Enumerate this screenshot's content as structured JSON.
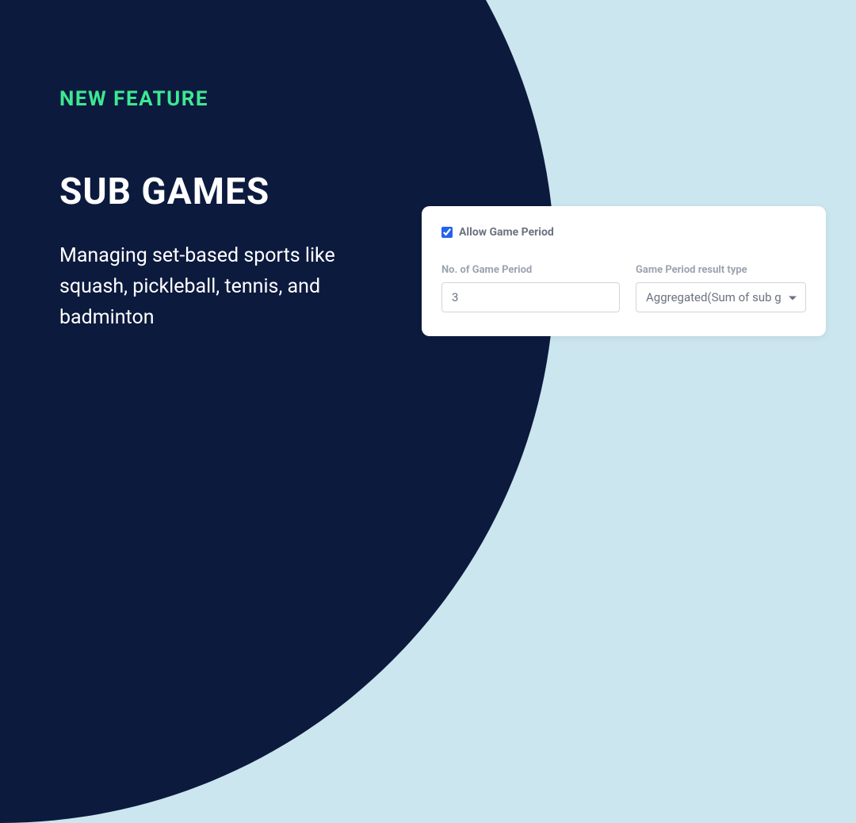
{
  "hero": {
    "badge": "NEW FEATURE",
    "title": "SUB GAMES",
    "description": "Managing set-based sports like squash, pickleball, tennis, and badminton"
  },
  "card": {
    "checkbox": {
      "label": "Allow Game Period",
      "checked": true
    },
    "fields": {
      "numPeriods": {
        "label": "No. of Game Period",
        "value": "3"
      },
      "resultType": {
        "label": "Game Period result type",
        "value": "Aggregated(Sum of sub g"
      }
    }
  },
  "colors": {
    "accent": "#3de891",
    "darkBg": "#0c1a3e",
    "lightBg": "#cce6ef"
  }
}
